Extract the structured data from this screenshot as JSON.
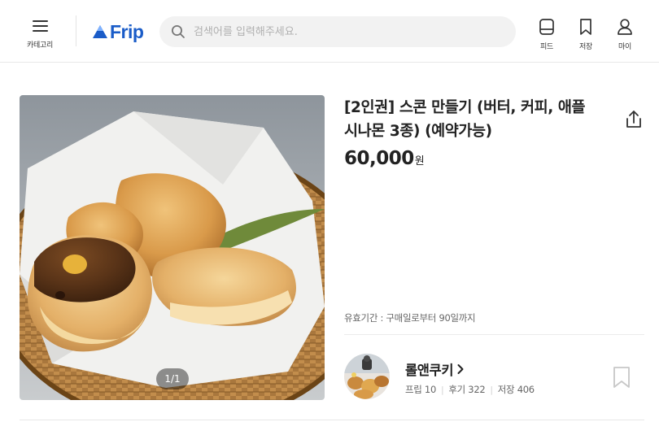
{
  "header": {
    "menu_label": "카테고리",
    "logo_text": "Frip",
    "search_placeholder": "검색어를 입력해주세요.",
    "nav": [
      {
        "label": "피드",
        "icon": "feed-icon"
      },
      {
        "label": "저장",
        "icon": "bookmark-icon"
      },
      {
        "label": "마이",
        "icon": "user-icon"
      }
    ]
  },
  "product": {
    "title": "[2인권] 스콘 만들기 (버터, 커피, 애플시나몬 3종) (예약가능)",
    "price_amount": "60,000",
    "price_unit": "원",
    "image_counter": "1/1",
    "validity": "유효기간 : 구매일로부터 90일까지"
  },
  "host": {
    "name": "롤앤쿠키",
    "stats": [
      {
        "label": "프립",
        "value": "10"
      },
      {
        "label": "후기",
        "value": "322"
      },
      {
        "label": "저장",
        "value": "406"
      }
    ]
  },
  "colors": {
    "brand": "#1a5cc8",
    "text_primary": "#222222",
    "text_secondary": "#666666",
    "search_bg": "#f2f2f2"
  },
  "icons": [
    "hamburger-menu-icon",
    "search-icon",
    "feed-icon",
    "bookmark-icon",
    "user-icon",
    "share-icon",
    "chevron-right-icon",
    "bookmark-outline-icon"
  ]
}
